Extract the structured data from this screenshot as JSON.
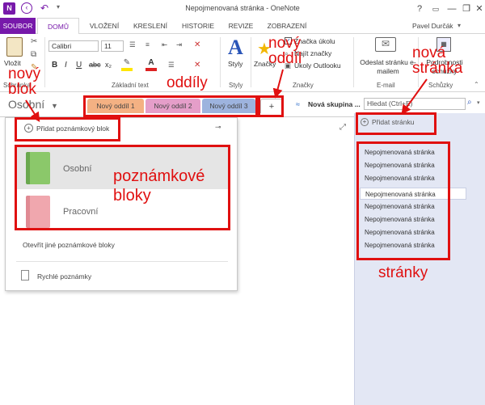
{
  "window": {
    "title": "Nepojmenovaná stránka - OneNote",
    "app_icon": "N",
    "help": "?",
    "minimize": "—",
    "restore": "❐",
    "close": "✕"
  },
  "tabs": [
    "SOUBOR",
    "DOMŮ",
    "VLOŽENÍ",
    "KRESLENÍ",
    "HISTORIE",
    "REVIZE",
    "ZOBRAZENÍ"
  ],
  "user": "Pavel Durčák",
  "ribbon": {
    "paste_label": "Vložit",
    "clipboard_label": "Schránka",
    "font_name": "Calibri",
    "font_size": "11",
    "basic_text_label": "Základní text",
    "styles_label": "Styly",
    "styles_button": "Styly",
    "tags_label": "Značky",
    "tags_button": "Značky",
    "tag_task": "Značka úkolu",
    "tag_find": "Najít značky",
    "tag_outlook": "Úkoly Outlooku",
    "email_button": "Odeslat stránku e-mailem",
    "email_label": "E-mail",
    "meeting_button": "Podrobnosti schůzky",
    "meetings_label": "Schůzky"
  },
  "notebook": {
    "current": "Osobní",
    "sections": [
      {
        "label": "Nový oddíl 1",
        "color": "#f4b183"
      },
      {
        "label": "Nový oddíl 2",
        "color": "#e59ec9"
      },
      {
        "label": "Nový oddíl 3",
        "color": "#9db3de"
      }
    ],
    "add_section": "+",
    "group_label": "Nová skupina ...",
    "search_placeholder": "Hledat (Ctrl+E)"
  },
  "dropdown": {
    "add_notebook": "Přidat poznámkový blok",
    "notebooks": [
      {
        "label": "Osobní",
        "color": "#8bc86a"
      },
      {
        "label": "Pracovní",
        "color": "#f0a7ae"
      }
    ],
    "open_other": "Otevřít jiné poznámkové bloky",
    "quick_notes": "Rychlé poznámky"
  },
  "pages": {
    "add_page": "Přidat stránku",
    "items": [
      "Nepojmenovaná stránka",
      "Nepojmenovaná stránka",
      "Nepojmenovaná stránka",
      "Nepojmenovaná stránka",
      "Nepojmenovaná stránka",
      "Nepojmenovaná stránka",
      "Nepojmenovaná stránka",
      "Nepojmenovaná stránka"
    ]
  },
  "annotations": {
    "new_block": [
      "nový",
      "blok"
    ],
    "sections": "oddíly",
    "new_section": [
      "nový",
      "oddíl"
    ],
    "new_page": [
      "nová",
      "stránka"
    ],
    "notebooks": [
      "poznámkové",
      "bloky"
    ],
    "pages": "stránky"
  },
  "colors": {
    "accent": "#7719aa",
    "annotation": "#e01010",
    "page_pane": "#e3e7f4"
  }
}
